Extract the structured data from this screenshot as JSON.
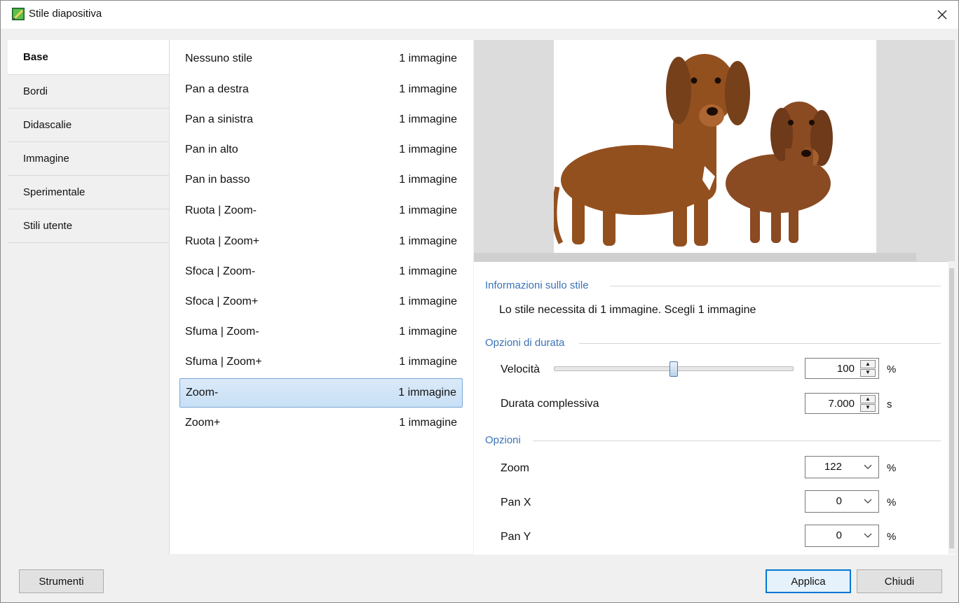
{
  "window": {
    "title": "Stile diapositiva"
  },
  "tabs": [
    {
      "label": "Base",
      "active": true
    },
    {
      "label": "Bordi"
    },
    {
      "label": "Didascalie"
    },
    {
      "label": "Immagine"
    },
    {
      "label": "Sperimentale"
    },
    {
      "label": "Stili utente"
    }
  ],
  "styles": [
    {
      "name": "Nessuno stile",
      "count": "1 immagine"
    },
    {
      "name": "Pan a destra",
      "count": "1 immagine"
    },
    {
      "name": "Pan a sinistra",
      "count": "1 immagine"
    },
    {
      "name": "Pan in alto",
      "count": "1 immagine"
    },
    {
      "name": "Pan in basso",
      "count": "1 immagine"
    },
    {
      "name": "Ruota | Zoom-",
      "count": "1 immagine"
    },
    {
      "name": "Ruota | Zoom+",
      "count": "1 immagine"
    },
    {
      "name": "Sfoca | Zoom-",
      "count": "1 immagine"
    },
    {
      "name": "Sfoca | Zoom+",
      "count": "1 immagine"
    },
    {
      "name": "Sfuma | Zoom-",
      "count": "1 immagine"
    },
    {
      "name": "Sfuma | Zoom+",
      "count": "1 immagine"
    },
    {
      "name": "Zoom-",
      "count": "1 immagine",
      "selected": true
    },
    {
      "name": "Zoom+",
      "count": "1 immagine"
    }
  ],
  "info": {
    "group_title": "Informazioni sullo stile",
    "text": "Lo stile necessita di 1 immagine. Scegli 1 immagine"
  },
  "duration": {
    "group_title": "Opzioni di durata",
    "speed_label": "Velocità",
    "speed_value": "100",
    "speed_unit": "%",
    "speed_slider_fraction": 0.5,
    "total_label": "Durata complessiva",
    "total_value": "7.000",
    "total_unit": "s"
  },
  "options": {
    "group_title": "Opzioni",
    "zoom_label": "Zoom",
    "zoom_value": "122",
    "zoom_unit": "%",
    "panx_label": "Pan X",
    "panx_value": "0",
    "panx_unit": "%",
    "pany_label": "Pan Y",
    "pany_value": "0",
    "pany_unit": "%"
  },
  "footer": {
    "tools_label": "Strumenti",
    "apply_label": "Applica",
    "close_label": "Chiudi"
  },
  "colors": {
    "accent": "#0078d7",
    "group_title": "#3a73b8",
    "selection": "#c8dff5"
  }
}
